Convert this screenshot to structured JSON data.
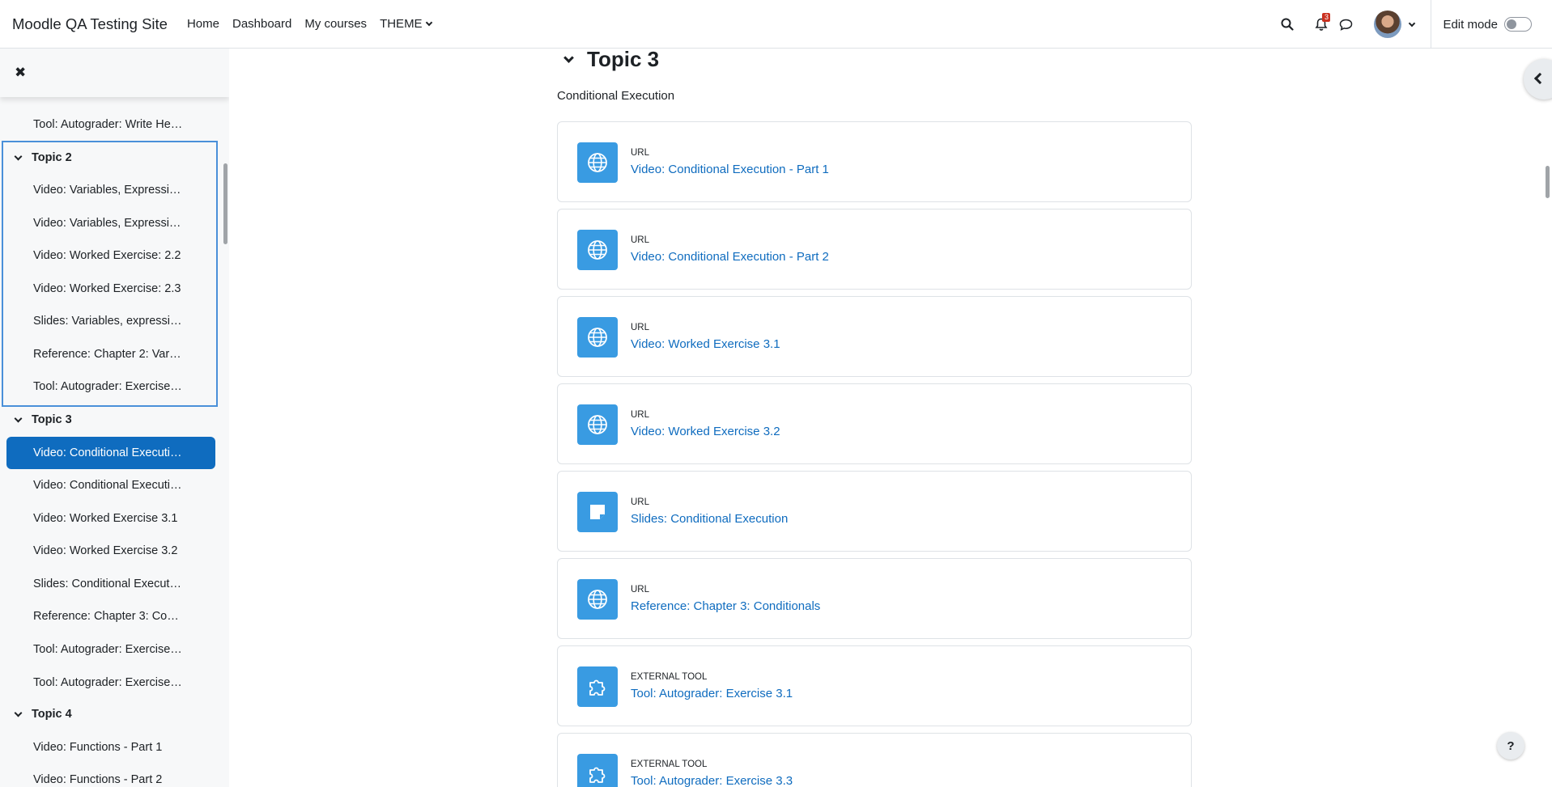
{
  "navbar": {
    "site_name": "Moodle QA Testing Site",
    "links": [
      "Home",
      "Dashboard",
      "My courses",
      "THEME"
    ],
    "notification_count": "3",
    "edit_mode_label": "Edit mode",
    "edit_mode_on": false
  },
  "drawer": {
    "partial_top_item": "Tool: Autograder: Write He…",
    "sections": [
      {
        "title": "Topic 2",
        "items": [
          "Video: Variables, Expressi…",
          "Video: Variables, Expressi…",
          "Video: Worked Exercise: 2.2",
          "Video: Worked Exercise: 2.3",
          "Slides: Variables, expressi…",
          "Reference: Chapter 2: Var…",
          "Tool: Autograder: Exercise…"
        ]
      },
      {
        "title": "Topic 3",
        "items": [
          "Video: Conditional Executi…",
          "Video: Conditional Executi…",
          "Video: Worked Exercise 3.1",
          "Video: Worked Exercise 3.2",
          "Slides: Conditional Execut…",
          "Reference: Chapter 3: Co…",
          "Tool: Autograder: Exercise…",
          "Tool: Autograder: Exercise…"
        ]
      },
      {
        "title": "Topic 4",
        "items": [
          "Video: Functions - Part 1",
          "Video: Functions - Part 2"
        ]
      }
    ]
  },
  "main": {
    "section_title": "Topic 3",
    "section_summary": "Conditional Execution",
    "activities": [
      {
        "type": "URL",
        "name": "Video: Conditional Execution - Part 1",
        "icon": "globe-icon"
      },
      {
        "type": "URL",
        "name": "Video: Conditional Execution - Part 2",
        "icon": "globe-icon"
      },
      {
        "type": "URL",
        "name": "Video: Worked Exercise 3.1",
        "icon": "globe-icon"
      },
      {
        "type": "URL",
        "name": "Video: Worked Exercise 3.2",
        "icon": "globe-icon"
      },
      {
        "type": "URL",
        "name": "Slides: Conditional Execution",
        "icon": "note-icon"
      },
      {
        "type": "URL",
        "name": "Reference: Chapter 3: Conditionals",
        "icon": "globe-icon"
      },
      {
        "type": "External tool",
        "name": "Tool: Autograder: Exercise 3.1",
        "icon": "puzzle-icon"
      },
      {
        "type": "External tool",
        "name": "Tool: Autograder: Exercise 3.3",
        "icon": "puzzle-icon"
      }
    ]
  },
  "help_label": "?",
  "colors": {
    "primary": "#0f6cbf",
    "activity_icon_bg": "#399be2",
    "focus_outline": "#4a90d9",
    "badge": "#ca3120"
  }
}
